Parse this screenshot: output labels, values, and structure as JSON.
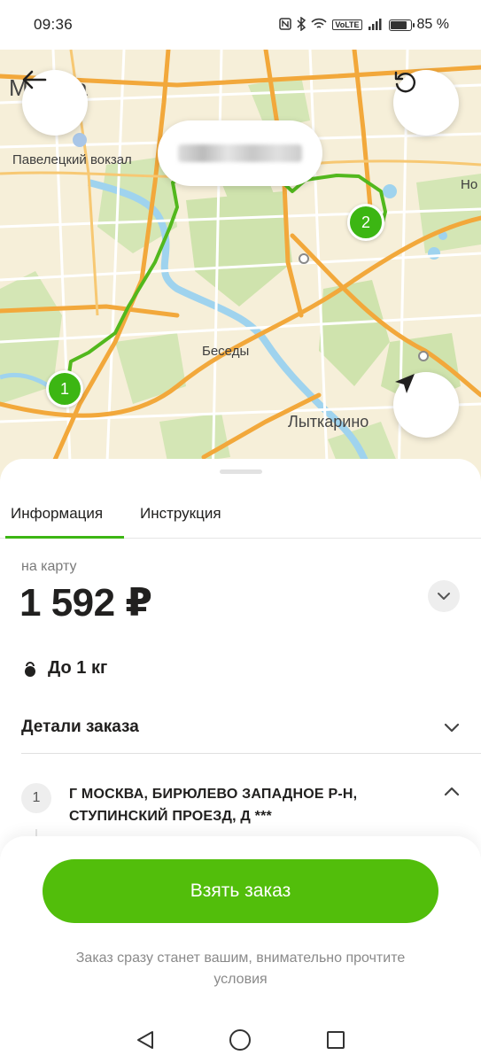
{
  "status_bar": {
    "time": "09:36",
    "battery_percent": "85 %",
    "battery_level": 0.85,
    "network_badge": "VoLTE"
  },
  "map": {
    "labels": {
      "moscow": "Москва",
      "station": "Павелецкий вокзал",
      "besedy": "Беседы",
      "lytkarino": "Лыткарино",
      "edge_label": "Но"
    },
    "pins": [
      {
        "label": "1"
      },
      {
        "label": "2"
      }
    ],
    "route_color": "#52b81d"
  },
  "sheet": {
    "tabs": [
      {
        "label": "Информация",
        "active": true
      },
      {
        "label": "Инструкция",
        "active": false
      }
    ],
    "price_caption": "на карту",
    "price": "1 592 ₽",
    "weight": "До 1 кг",
    "details_title": "Детали заказа",
    "stops": [
      {
        "number": "1",
        "address": "Г МОСКВА, БИРЮЛЕВО ЗАПАДНОЕ Р-Н, СТУПИНСКИЙ ПРОЕЗД, Д ***"
      }
    ]
  },
  "actions": {
    "take_order_label": "Взять заказ",
    "terms_note": "Заказ сразу станет вашим, внимательно прочтите условия"
  },
  "colors": {
    "accent": "#52be0b",
    "pin": "#3cb613"
  }
}
